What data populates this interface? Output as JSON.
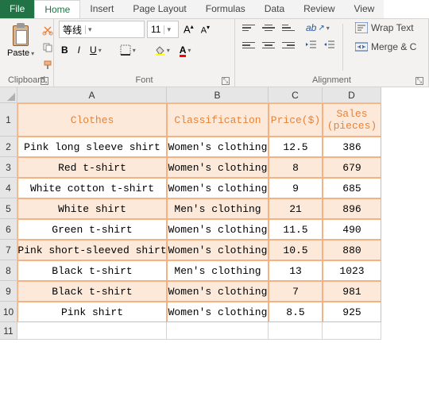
{
  "tabs": {
    "file": "File",
    "home": "Home",
    "insert": "Insert",
    "page_layout": "Page Layout",
    "formulas": "Formulas",
    "data": "Data",
    "review": "Review",
    "view": "View"
  },
  "ribbon": {
    "clipboard": {
      "paste": "Paste",
      "label": "Clipboard"
    },
    "font": {
      "name": "等线",
      "size": "11",
      "label": "Font"
    },
    "alignment": {
      "wrap": "Wrap Text",
      "merge": "Merge & C",
      "label": "Alignment"
    }
  },
  "columns": [
    "A",
    "B",
    "C",
    "D"
  ],
  "row_labels": [
    "1",
    "2",
    "3",
    "4",
    "5",
    "6",
    "7",
    "8",
    "9",
    "10",
    "11"
  ],
  "headers": {
    "A": "Clothes",
    "B": "Classification",
    "C": "Price($)",
    "D": "Sales (pieces)"
  },
  "chart_data": {
    "type": "table",
    "columns": [
      "Clothes",
      "Classification",
      "Price($)",
      "Sales (pieces)"
    ],
    "rows": [
      {
        "Clothes": "Pink long sleeve shirt",
        "Classification": "Women's clothing",
        "Price($)": 12.5,
        "Sales (pieces)": 386
      },
      {
        "Clothes": "Red t-shirt",
        "Classification": "Women's clothing",
        "Price($)": 8,
        "Sales (pieces)": 679
      },
      {
        "Clothes": "White cotton t-shirt",
        "Classification": "Women's clothing",
        "Price($)": 9,
        "Sales (pieces)": 685
      },
      {
        "Clothes": "White shirt",
        "Classification": "Men's clothing",
        "Price($)": 21,
        "Sales (pieces)": 896
      },
      {
        "Clothes": "Green t-shirt",
        "Classification": "Women's clothing",
        "Price($)": 11.5,
        "Sales (pieces)": 490
      },
      {
        "Clothes": "Pink short-sleeved shirt",
        "Classification": "Women's clothing",
        "Price($)": 10.5,
        "Sales (pieces)": 880
      },
      {
        "Clothes": "Black t-shirt",
        "Classification": "Men's clothing",
        "Price($)": 13,
        "Sales (pieces)": 1023
      },
      {
        "Clothes": "Black t-shirt",
        "Classification": "Women's clothing",
        "Price($)": 7,
        "Sales (pieces)": 981
      },
      {
        "Clothes": "Pink shirt",
        "Classification": "Women's clothing",
        "Price($)": 8.5,
        "Sales (pieces)": 925
      }
    ]
  }
}
